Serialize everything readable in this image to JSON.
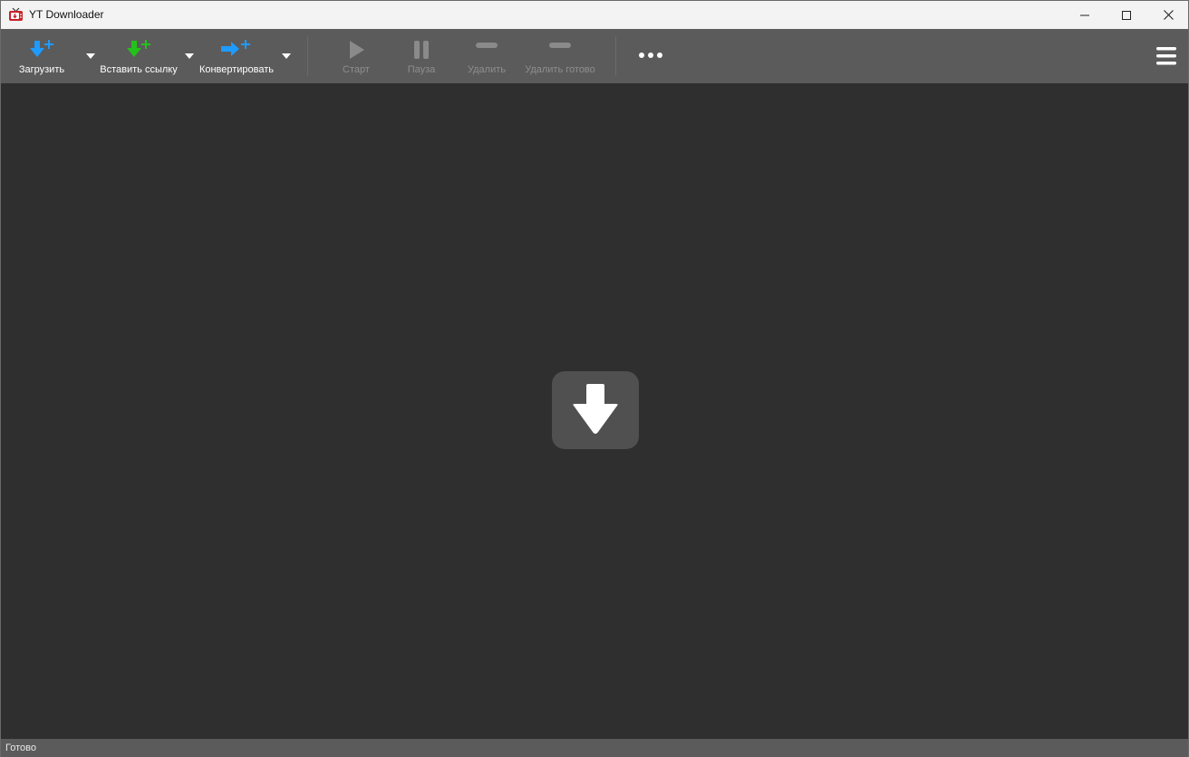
{
  "window": {
    "title": "YT Downloader",
    "app_icon": "tv-icon"
  },
  "toolbar": {
    "download": {
      "label": "Загрузить",
      "icon": "download-plus-icon",
      "color": "#1e9bff"
    },
    "paste_link": {
      "label": "Вставить ссылку",
      "icon": "paste-link-plus-icon",
      "color": "#22c21a"
    },
    "convert": {
      "label": "Конвертировать",
      "icon": "convert-plus-icon",
      "color": "#1e9bff"
    },
    "start": {
      "label": "Старт",
      "icon": "play-icon",
      "enabled": false
    },
    "pause": {
      "label": "Пауза",
      "icon": "pause-icon",
      "enabled": false
    },
    "delete": {
      "label": "Удалить",
      "icon": "minus-icon",
      "enabled": false
    },
    "delete_done": {
      "label": "Удалить готово",
      "icon": "minus-icon",
      "enabled": false
    },
    "more_icon": "more-dots-icon",
    "menu_icon": "hamburger-menu-icon"
  },
  "main": {
    "empty_icon": "download-arrow-icon"
  },
  "status": {
    "text": "Готово"
  }
}
